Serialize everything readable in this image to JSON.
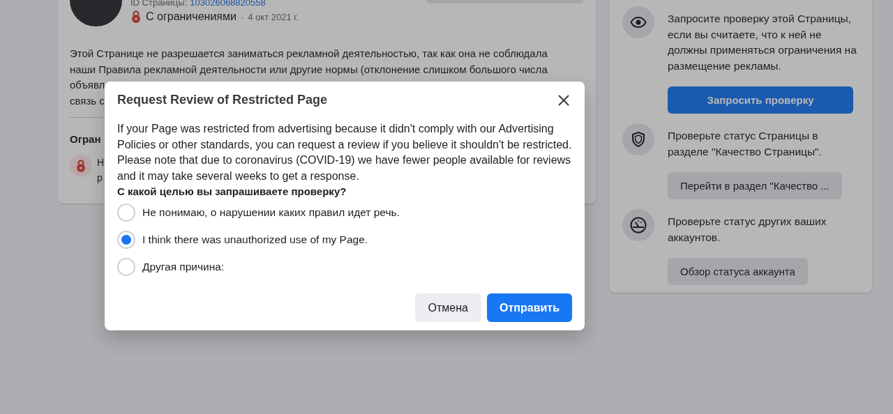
{
  "page_header": {
    "id_label": "ID Страницы:",
    "id_value": "103026068820558",
    "status": "С ограничениями",
    "separator": "·",
    "date": "4 окт 2021 г."
  },
  "description_lines": [
    "Этой Странице не разрешается заниматься рекламной деятельностью, так как она не соблюдала",
    "наши Правила рекламной деятельности или другие нормы (отклонение слишком большого числа",
    "объявл",
    "связь с"
  ],
  "section_heading": "Огран",
  "restriction_item": {
    "line_1": "Н",
    "line_2": "р"
  },
  "actions": [
    {
      "text": "Запросите проверку этой Страницы, если вы считаете, что к ней не должны применяться ограничения на размещение рекламы.",
      "button": "Запросить проверку",
      "kind": "primary"
    },
    {
      "text": "Проверьте статус Страницы в разделе \"Качество Страницы\".",
      "button": "Перейти в раздел \"Качество ...",
      "kind": "secondary"
    },
    {
      "text": "Проверьте статус других ваших аккаунтов.",
      "button": "Обзор статуса аккаунта",
      "kind": "secondary"
    }
  ],
  "dialog": {
    "title": "Request Review of Restricted Page",
    "body": "If your Page was restricted from advertising because it didn't comply with our Advertising Policies or other standards, you can request a review if you believe it shouldn't be restricted. Please note that due to coronavirus (COVID-19) we have fewer people available for reviews and it may take several weeks to get a response.",
    "question": "С какой целью вы запрашиваете проверку?",
    "options": [
      {
        "label": "Не понимаю, о нарушении каких правил идет речь.",
        "selected": false
      },
      {
        "label": "I think there was unauthorized use of my Page.",
        "selected": true
      },
      {
        "label": "Другая причина:",
        "selected": false
      }
    ],
    "buttons": [
      {
        "label": "Отмена",
        "kind": "secondary"
      },
      {
        "label": "Отправить",
        "kind": "primary"
      }
    ]
  }
}
